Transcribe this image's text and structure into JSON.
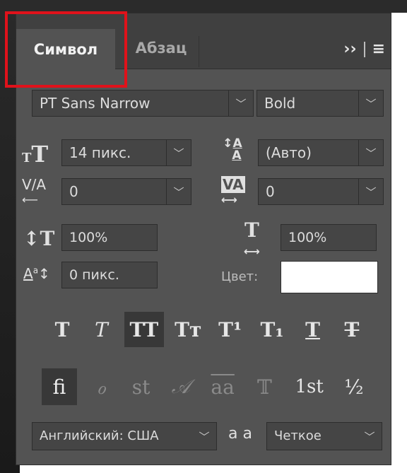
{
  "tabs": {
    "character": "Символ",
    "paragraph": "Абзац"
  },
  "tab_icons": {
    "expand": "››",
    "menu": "≡"
  },
  "font": {
    "family": "PT Sans Narrow",
    "style": "Bold"
  },
  "size": {
    "font_size": "14 пикс.",
    "leading": "(Авто)",
    "kerning": "0",
    "tracking": "0"
  },
  "scale": {
    "vertical": "100%",
    "horizontal": "100%"
  },
  "baseline": {
    "shift": "0 пикс.",
    "color_label": "Цвет:",
    "color": "#ffffff"
  },
  "type_styles": [
    {
      "name": "faux-bold-button",
      "glyph": "T"
    },
    {
      "name": "faux-italic-button",
      "glyph": "T"
    },
    {
      "name": "all-caps-button",
      "glyph": "TT"
    },
    {
      "name": "small-caps-button",
      "glyph": "Tт"
    },
    {
      "name": "superscript-button",
      "glyph": "T¹"
    },
    {
      "name": "subscript-button",
      "glyph": "T₁"
    },
    {
      "name": "underline-button",
      "glyph": "T"
    },
    {
      "name": "strikethrough-button",
      "glyph": "T"
    }
  ],
  "opentype": [
    {
      "name": "standard-ligatures-button",
      "glyph": "fi"
    },
    {
      "name": "contextual-alternates-button",
      "glyph": "ℴ"
    },
    {
      "name": "discretionary-ligatures-button",
      "glyph": "st"
    },
    {
      "name": "swash-button",
      "glyph": "𝒜"
    },
    {
      "name": "stylistic-alternates-button",
      "glyph": "aa"
    },
    {
      "name": "titling-alternates-button",
      "glyph": "𝕋"
    },
    {
      "name": "ordinals-button",
      "glyph": "1st"
    },
    {
      "name": "fractions-button",
      "glyph": "½"
    }
  ],
  "language": {
    "value": "Английский: США",
    "antialias": "Четкое",
    "aa_icon": "a a"
  }
}
